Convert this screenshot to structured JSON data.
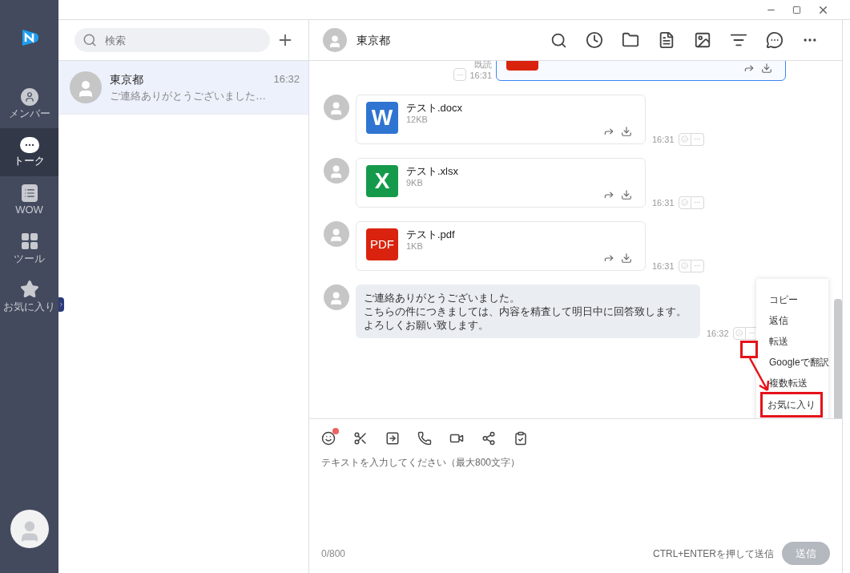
{
  "nav": {
    "items": [
      {
        "kind": "member",
        "label": "メンバー",
        "selected": false
      },
      {
        "kind": "talk",
        "label": "トーク",
        "selected": true
      },
      {
        "kind": "wow",
        "label": "WOW",
        "selected": false
      },
      {
        "kind": "tools",
        "label": "ツール",
        "selected": false
      },
      {
        "kind": "favorite",
        "label": "お気に入り",
        "selected": false
      }
    ]
  },
  "conversations": {
    "search": {
      "placeholder": "検索"
    },
    "items": [
      {
        "name": "東京都",
        "time": "16:32",
        "preview": "ご連絡ありがとうございました…",
        "selected": true
      }
    ]
  },
  "chat": {
    "title": "東京都",
    "messages": [
      {
        "kind": "sent_file",
        "selected": true,
        "color": "#d9230f",
        "read_label": "既読",
        "time": "16:31"
      },
      {
        "kind": "file",
        "selected": false,
        "color": "#2f74d0",
        "badge": "W",
        "name": "テスト.docx",
        "size": "12KB",
        "time": "16:31"
      },
      {
        "kind": "file",
        "selected": false,
        "color": "#159a4b",
        "badge": "X",
        "name": "テスト.xlsx",
        "size": "9KB",
        "time": "16:31"
      },
      {
        "kind": "file",
        "selected": false,
        "color": "#d9230f",
        "badge": "PDF",
        "name": "テスト.pdf",
        "size": "1KB",
        "time": "16:31"
      },
      {
        "kind": "text",
        "lines": [
          "ご連絡ありがとうございました。",
          "こちらの件につきましては、内容を精査して明日中に回答致します。",
          "よろしくお願い致します。"
        ],
        "time": "16:32"
      }
    ]
  },
  "context_menu": {
    "items": [
      {
        "label": "コピー",
        "annotated": false
      },
      {
        "label": "返信",
        "annotated": false
      },
      {
        "label": "転送",
        "annotated": false
      },
      {
        "label": "Googleで翻訳",
        "annotated": false
      },
      {
        "label": "複数転送",
        "annotated": false
      },
      {
        "label": "お気に入り",
        "annotated": true
      }
    ]
  },
  "composer": {
    "emoji_notification": true,
    "placeholder": "テキストを入力してください（最大800文字）",
    "counter": "0/800",
    "hint": "CTRL+ENTERを押して送信",
    "send_button": {
      "label": "送信",
      "disabled": true
    }
  }
}
